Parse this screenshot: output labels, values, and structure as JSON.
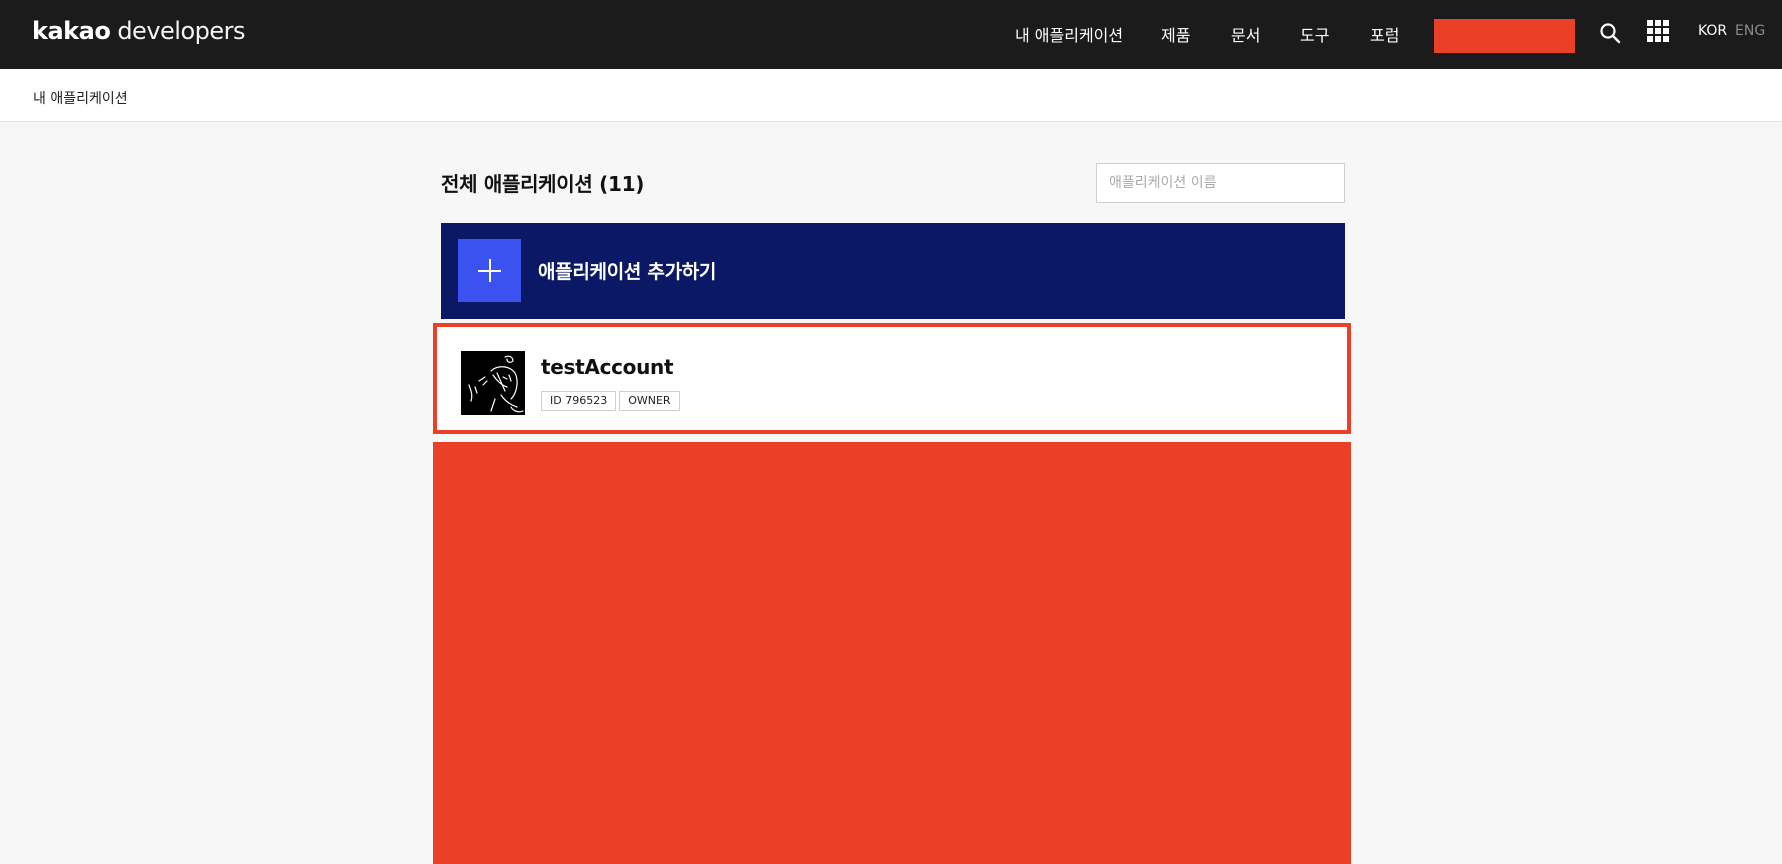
{
  "header": {
    "logo_bold": "kakao",
    "logo_light": "developers",
    "nav": [
      "내 애플리케이션",
      "제품",
      "문서",
      "도구",
      "포럼"
    ],
    "search_icon": "search-icon",
    "apps_icon": "apps-grid-icon",
    "lang_active": "KOR",
    "lang_inactive": "ENG",
    "cta_color": "#e94027"
  },
  "breadcrumb": "내 애플리케이션",
  "main": {
    "title": "전체 애플리케이션 (11)",
    "search_placeholder": "애플리케이션 이름",
    "add_app_label": "애플리케이션 추가하기",
    "apps": [
      {
        "name": "testAccount",
        "badges": [
          "ID 796523",
          "OWNER"
        ]
      }
    ]
  },
  "colors": {
    "header_bg": "#1b1b1c",
    "add_card_bg": "#0b1866",
    "add_plus_bg": "#3c52f0",
    "highlight": "#e94027"
  }
}
